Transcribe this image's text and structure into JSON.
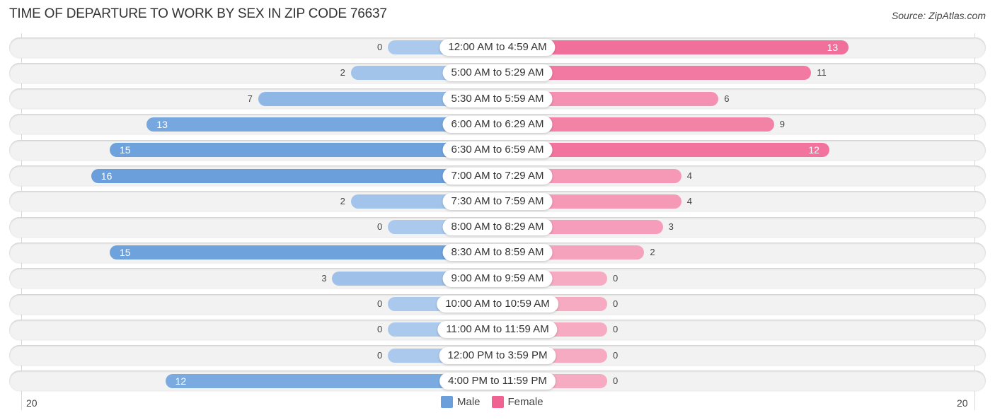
{
  "header": {
    "title": "TIME OF DEPARTURE TO WORK BY SEX IN ZIP CODE 76637",
    "source": "Source: ZipAtlas.com"
  },
  "colors": {
    "male": "#6a9fdb",
    "male_light": "#abc9ec",
    "female": "#f06292",
    "female_light": "#f6abc3"
  },
  "chart_data": {
    "type": "bar",
    "orientation": "horizontal-diverging",
    "title": "TIME OF DEPARTURE TO WORK BY SEX IN ZIP CODE 76637",
    "categories": [
      "12:00 AM to 4:59 AM",
      "5:00 AM to 5:29 AM",
      "5:30 AM to 5:59 AM",
      "6:00 AM to 6:29 AM",
      "6:30 AM to 6:59 AM",
      "7:00 AM to 7:29 AM",
      "7:30 AM to 7:59 AM",
      "8:00 AM to 8:29 AM",
      "8:30 AM to 8:59 AM",
      "9:00 AM to 9:59 AM",
      "10:00 AM to 10:59 AM",
      "11:00 AM to 11:59 AM",
      "12:00 PM to 3:59 PM",
      "4:00 PM to 11:59 PM"
    ],
    "series": [
      {
        "name": "Male",
        "values": [
          0,
          2,
          7,
          13,
          15,
          16,
          2,
          0,
          15,
          3,
          0,
          0,
          0,
          12
        ]
      },
      {
        "name": "Female",
        "values": [
          13,
          11,
          6,
          9,
          12,
          4,
          4,
          3,
          2,
          0,
          0,
          0,
          0,
          0
        ]
      }
    ],
    "axis": {
      "left_label": "20",
      "right_label": "20",
      "range": [
        0,
        20
      ]
    },
    "legend": {
      "position": "bottom-center",
      "entries": [
        "Male",
        "Female"
      ]
    },
    "grid": false
  }
}
